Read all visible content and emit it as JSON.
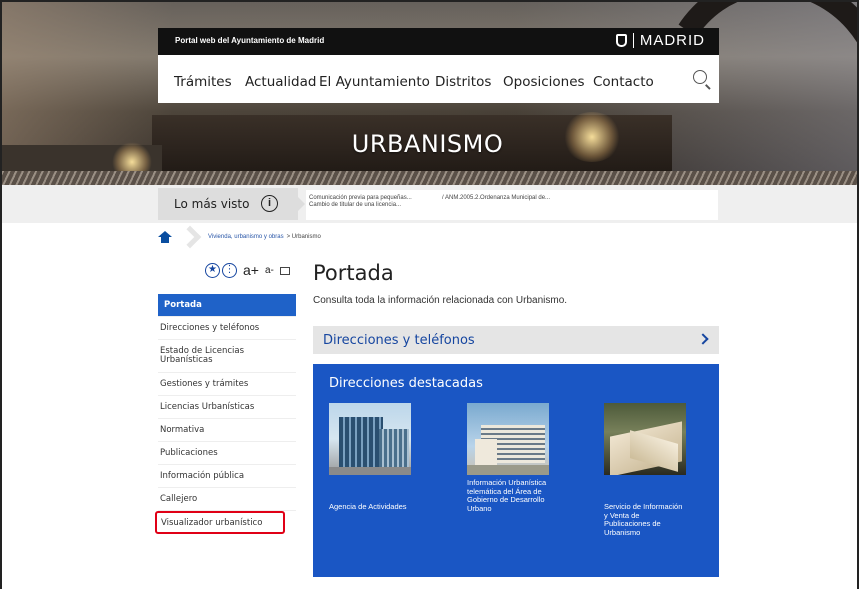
{
  "header": {
    "portal_text": "Portal web del Ayuntamiento de Madrid",
    "brand": "MADRID",
    "nav": [
      "Trámites",
      "Actualidad",
      "El Ayuntamiento",
      "Distritos",
      "Oposiciones",
      "Contacto"
    ],
    "hero_title": "URBANISMO"
  },
  "mas_visto": {
    "label": "Lo más visto",
    "links": [
      "Comunicación previa para pequeñas... Cambio de titular de una licencia...",
      "/ ANM.2005.2.Ordenanza Municipal de..."
    ]
  },
  "breadcrumb": {
    "items": [
      "Vivienda, urbanismo y obras",
      "> Urbanismo"
    ]
  },
  "tools": {
    "bigger": "a+",
    "smaller": "a-"
  },
  "sidebar": {
    "items": [
      "Portada",
      "Direcciones y teléfonos",
      "Estado de Licencias Urbanísticas",
      "Gestiones y trámites",
      "Licencias Urbanísticas",
      "Normativa",
      "Publicaciones",
      "Información pública",
      "Callejero",
      "Visualizador urbanístico"
    ]
  },
  "main": {
    "title": "Portada",
    "intro": "Consulta toda la información relacionada con Urbanismo.",
    "direcciones_bar": "Direcciones y teléfonos",
    "destacadas": {
      "heading": "Direcciones destacadas",
      "cards": [
        "Agencia de Actividades",
        "Información Urbanística telemática del Área de Gobierno de Desarrollo Urbano",
        "Servicio de Información y Venta de Publicaciones de Urbanismo"
      ]
    }
  },
  "colors": {
    "accent_blue": "#1f62c8",
    "panel_blue": "#1a56c4",
    "highlight_red": "#e00016"
  }
}
